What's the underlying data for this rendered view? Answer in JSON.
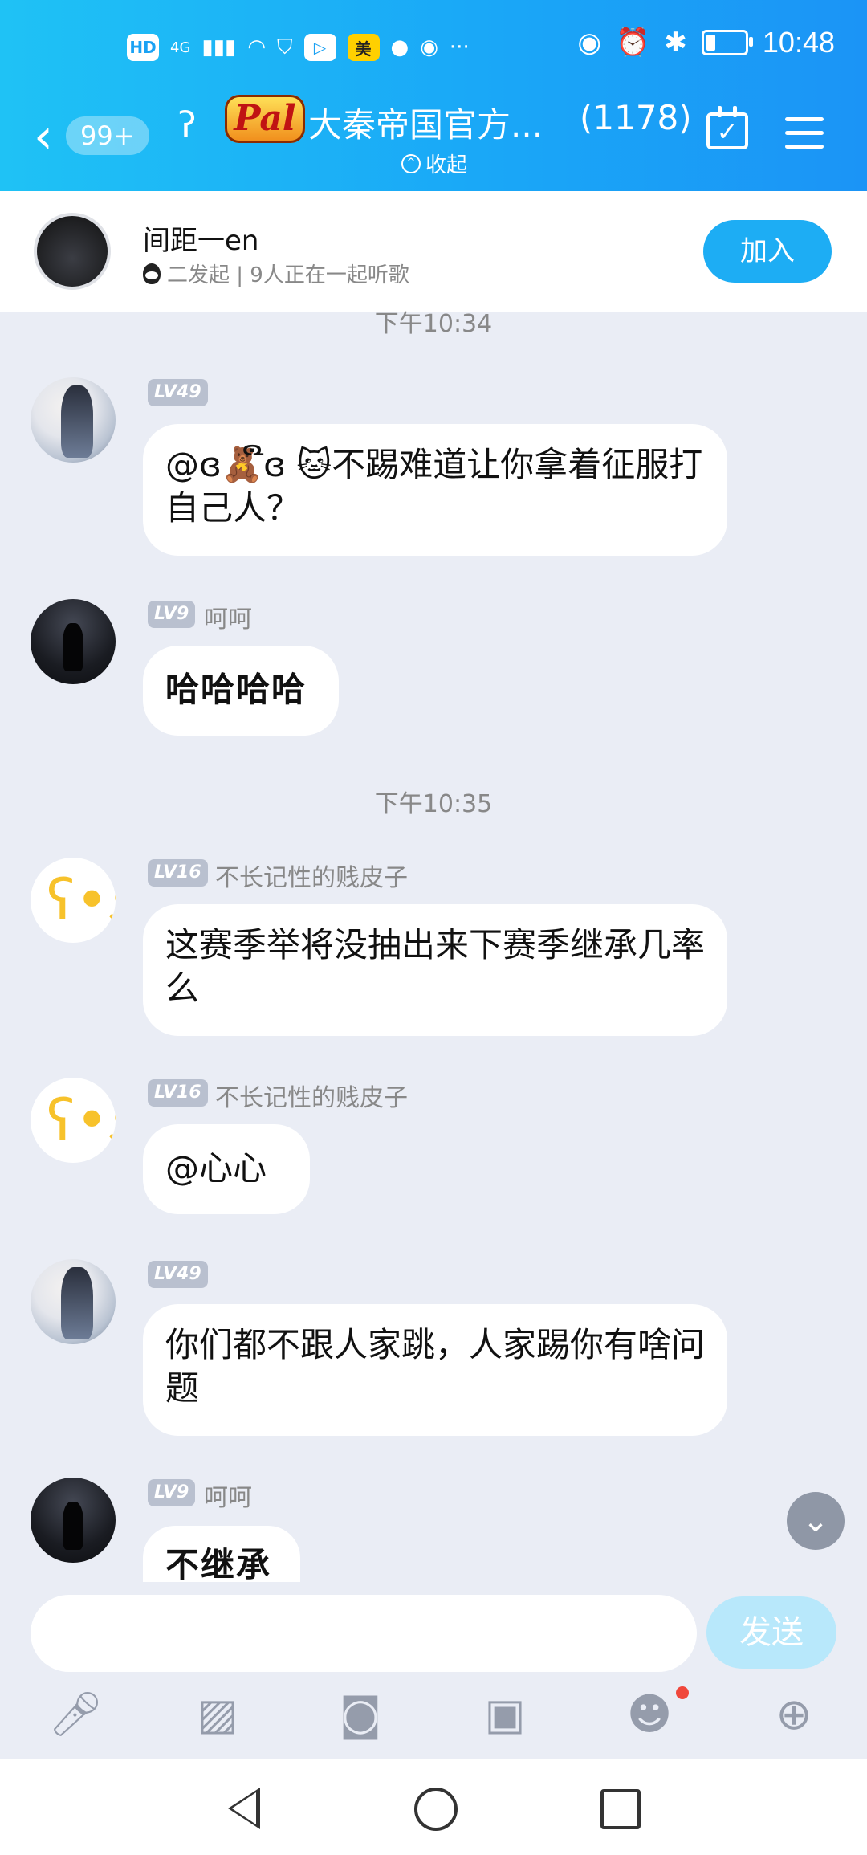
{
  "status_bar": {
    "time": "10:48",
    "network": "4G",
    "hd": "HD",
    "meituan_label": "美",
    "more": "···",
    "battery_level": 0.25
  },
  "header": {
    "back_badge": "99+",
    "logo_text": "Pal",
    "group_title": "大秦帝国官方...",
    "member_count": "(1178)",
    "collapse_label": "收起"
  },
  "listening": {
    "name": "间距一en",
    "subtitle": "二发起 | 9人正在一起听歌",
    "join_label": "加入"
  },
  "chat": {
    "time_top": "下午10:34",
    "time_mid": "下午10:35",
    "messages": [
      {
        "level": "LV49",
        "nick": "",
        "text": "@ɞ🧸ືɞ 🐱不踢难道让你拿着征服打自己人？"
      },
      {
        "level": "LV9",
        "nick": "呵呵",
        "text": "哈哈哈哈"
      },
      {
        "level": "LV16",
        "nick": "不长记性的贱皮子",
        "text": "这赛季举将没抽出来下赛季继承几率么"
      },
      {
        "level": "LV16",
        "nick": "不长记性的贱皮子",
        "text": "@心心"
      },
      {
        "level": "LV49",
        "nick": "",
        "text": "你们都不跟人家跳，人家踢你有啥问题"
      },
      {
        "level": "LV9",
        "nick": "呵呵",
        "text": "不继承"
      }
    ]
  },
  "input": {
    "placeholder": "",
    "send_label": "发送"
  },
  "icons": {
    "toolbar": [
      "microphone-icon",
      "image-icon",
      "camera-icon",
      "red-packet-icon",
      "emoji-icon",
      "plus-icon"
    ]
  }
}
